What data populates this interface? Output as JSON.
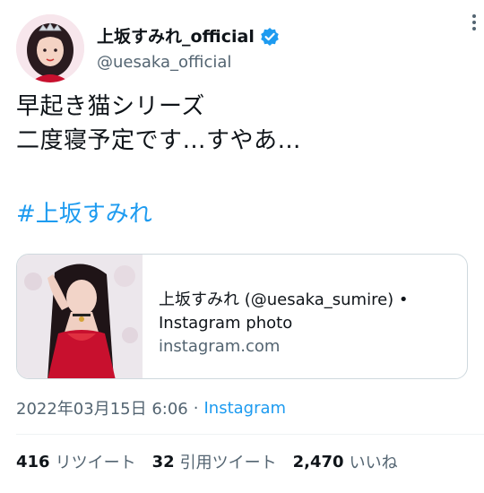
{
  "author": {
    "display_name": "上坂すみれ_official",
    "handle": "@uesaka_official",
    "verified": true
  },
  "tweet": {
    "lines": [
      "早起き猫シリーズ",
      "二度寝予定です…すやあ…"
    ],
    "hashtag": "#上坂すみれ"
  },
  "card": {
    "title_line1": "上坂すみれ (@uesaka_sumire) •",
    "title_line2": "Instagram photo",
    "domain": "instagram.com"
  },
  "meta": {
    "timestamp": "2022年03月15日 6:06",
    "separator": "·",
    "source": "Instagram"
  },
  "stats": [
    {
      "count": "416",
      "label": "リツイート"
    },
    {
      "count": "32",
      "label": "引用ツイート"
    },
    {
      "count": "2,470",
      "label": "いいね"
    }
  ],
  "colors": {
    "accent": "#1d9bf0",
    "text": "#0f1419",
    "secondary": "#536471"
  }
}
